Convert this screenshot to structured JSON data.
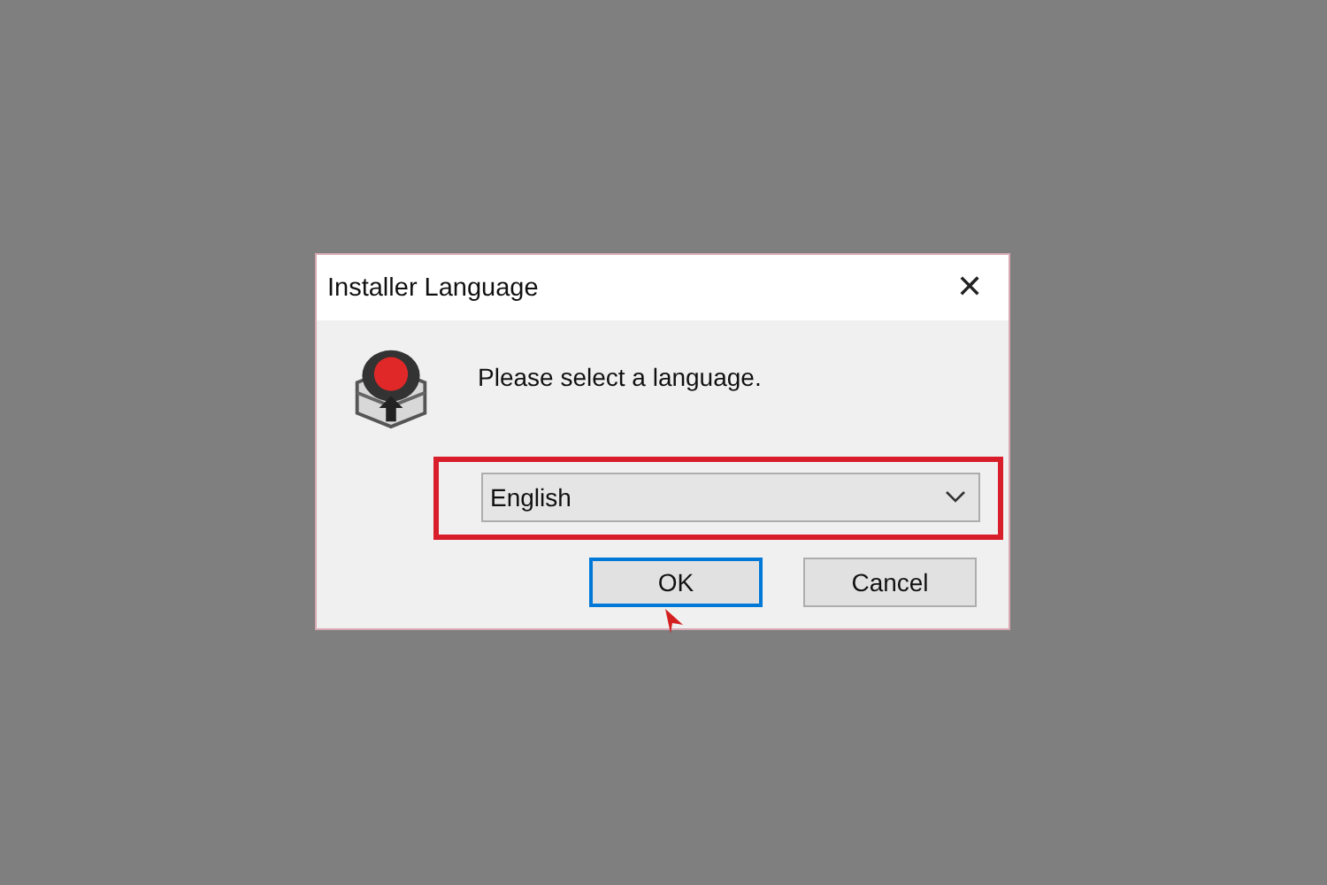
{
  "window": {
    "title": "Installer Language",
    "close": "✕"
  },
  "message": "Please select a language.",
  "language_dropdown": {
    "value": "English",
    "highlighted": true
  },
  "buttons": [
    {
      "label": "OK",
      "default": true
    },
    {
      "label": "Cancel",
      "default": false
    }
  ]
}
